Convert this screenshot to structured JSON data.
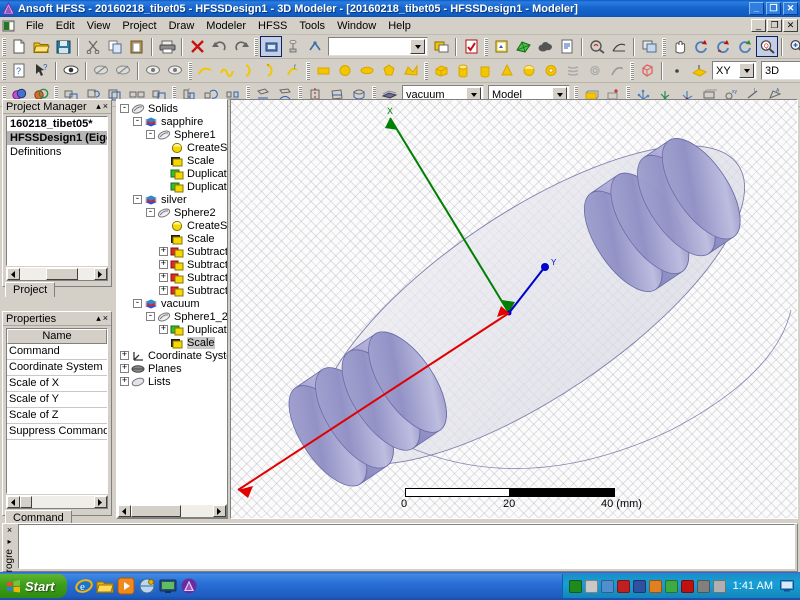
{
  "window": {
    "title": "Ansoft HFSS  - 20160218_tibet05 - HFSSDesign1 - 3D Modeler - [20160218_tibet05 - HFSSDesign1 - Modeler]",
    "app_icon": "ansoft-logo-icon",
    "buttons": {
      "minimize": "_",
      "restore": "❐",
      "close": "✕"
    },
    "mdi_buttons": {
      "minimize": "_",
      "restore": "❐",
      "close": "✕"
    }
  },
  "menubar": {
    "mdi_icon": "mdi-document-icon",
    "items": [
      "File",
      "Edit",
      "View",
      "Project",
      "Draw",
      "Modeler",
      "HFSS",
      "Tools",
      "Window",
      "Help"
    ]
  },
  "toolbars": {
    "row1": [
      {
        "type": "grip"
      },
      {
        "type": "button",
        "name": "new-file-button",
        "icon": "new-document-icon"
      },
      {
        "type": "button",
        "name": "open-file-button",
        "icon": "open-folder-icon"
      },
      {
        "type": "button",
        "name": "save-file-button",
        "icon": "floppy-save-icon"
      },
      {
        "type": "sep"
      },
      {
        "type": "button",
        "name": "cut-button",
        "icon": "scissors-icon"
      },
      {
        "type": "button",
        "name": "copy-button",
        "icon": "copy-icon"
      },
      {
        "type": "button",
        "name": "paste-button",
        "icon": "paste-icon"
      },
      {
        "type": "sep"
      },
      {
        "type": "button",
        "name": "print-button",
        "icon": "printer-icon"
      },
      {
        "type": "sep"
      },
      {
        "type": "button",
        "name": "delete-button",
        "icon": "red-x-icon"
      },
      {
        "type": "button",
        "name": "undo-button",
        "icon": "undo-arrow-icon"
      },
      {
        "type": "button",
        "name": "redo-button",
        "icon": "redo-arrow-icon"
      },
      {
        "type": "grip"
      },
      {
        "type": "button",
        "name": "select-object-button",
        "icon": "select-object-icon",
        "pressed": true
      },
      {
        "type": "button",
        "name": "select-face-button",
        "icon": "select-face-icon"
      },
      {
        "type": "button",
        "name": "select-edge-button",
        "icon": "select-edge-icon"
      },
      {
        "type": "combo",
        "name": "select-filter-combo",
        "value": ""
      },
      {
        "type": "button",
        "name": "select-multi-button",
        "icon": "multi-select-icon"
      },
      {
        "type": "sep"
      },
      {
        "type": "button",
        "name": "validate-button",
        "icon": "validation-check-icon"
      },
      {
        "type": "grip"
      },
      {
        "type": "button",
        "name": "analyze-all-button",
        "icon": "analyze-icon"
      },
      {
        "type": "button",
        "name": "mesh-button",
        "icon": "green-mesh-icon"
      },
      {
        "type": "button",
        "name": "cloud-button",
        "icon": "cloud-icon"
      },
      {
        "type": "button",
        "name": "report-button",
        "icon": "report-icon"
      },
      {
        "type": "sep"
      },
      {
        "type": "button",
        "name": "field-overlay-button",
        "icon": "field-overlay-icon"
      },
      {
        "type": "button",
        "name": "plot-curve-button",
        "icon": "plot-curve-icon"
      },
      {
        "type": "sep"
      },
      {
        "type": "button",
        "name": "duplicate-window-button",
        "icon": "window-copy-icon"
      },
      {
        "type": "grip"
      },
      {
        "type": "button",
        "name": "pan-button",
        "icon": "hand-pan-icon"
      },
      {
        "type": "button",
        "name": "rotate-button",
        "icon": "rotate-icon"
      },
      {
        "type": "button",
        "name": "dynamic-rotate-button",
        "icon": "rotate-dynamic-icon"
      },
      {
        "type": "button",
        "name": "spin-button",
        "icon": "spin-icon"
      },
      {
        "type": "button",
        "name": "zoom-button",
        "icon": "zoom-magnifier-icon",
        "pressed": true
      },
      {
        "type": "sep"
      },
      {
        "type": "button",
        "name": "zoom-in-button",
        "icon": "zoom-in-icon"
      },
      {
        "type": "button",
        "name": "zoom-out-button",
        "icon": "zoom-out-icon"
      },
      {
        "type": "sep"
      },
      {
        "type": "button",
        "name": "fit-all-button",
        "icon": "fit-all-icon"
      },
      {
        "type": "button",
        "name": "fit-selection-button",
        "icon": "fit-selection-icon"
      }
    ],
    "row2": [
      {
        "type": "grip"
      },
      {
        "type": "button",
        "name": "measure-button",
        "icon": "measure-help-icon"
      },
      {
        "type": "button",
        "name": "context-help-button",
        "icon": "arrow-help-icon"
      },
      {
        "type": "sep"
      },
      {
        "type": "button",
        "name": "view-all-button",
        "icon": "eye-view-icon"
      },
      {
        "type": "sep"
      },
      {
        "type": "button",
        "name": "hide-selection-button",
        "icon": "hide-object-icon"
      },
      {
        "type": "button",
        "name": "hide-unselected-button",
        "icon": "hide-unselected-icon"
      },
      {
        "type": "sep"
      },
      {
        "type": "button",
        "name": "show-selection-button",
        "icon": "show-object-icon"
      },
      {
        "type": "button",
        "name": "show-all-button",
        "icon": "show-all-icon"
      },
      {
        "type": "grip"
      },
      {
        "type": "button",
        "name": "draw-line-button",
        "icon": "draw-line-icon"
      },
      {
        "type": "button",
        "name": "draw-spline-button",
        "icon": "draw-spline-icon"
      },
      {
        "type": "button",
        "name": "draw-arc-center-button",
        "icon": "draw-arc-icon"
      },
      {
        "type": "button",
        "name": "draw-arc-3point-button",
        "icon": "draw-arc3-icon"
      },
      {
        "type": "button",
        "name": "draw-equation-button",
        "icon": "draw-equation-icon"
      },
      {
        "type": "grip"
      },
      {
        "type": "button",
        "name": "draw-rectangle-button",
        "icon": "rectangle-icon"
      },
      {
        "type": "button",
        "name": "draw-circle-button",
        "icon": "circle-icon"
      },
      {
        "type": "button",
        "name": "draw-ellipse-button",
        "icon": "ellipse-icon"
      },
      {
        "type": "button",
        "name": "draw-regular-polygon-button",
        "icon": "regular-polygon-icon"
      },
      {
        "type": "button",
        "name": "draw-polyline-button",
        "icon": "polyline-surface-icon"
      },
      {
        "type": "grip"
      },
      {
        "type": "button",
        "name": "draw-box-button",
        "icon": "box-icon"
      },
      {
        "type": "button",
        "name": "draw-cylinder-button",
        "icon": "cylinder-icon"
      },
      {
        "type": "button",
        "name": "draw-regular-polyhedron-button",
        "icon": "polyhedron-icon"
      },
      {
        "type": "button",
        "name": "draw-cone-button",
        "icon": "cone-icon"
      },
      {
        "type": "button",
        "name": "draw-sphere-button",
        "icon": "sphere-icon"
      },
      {
        "type": "button",
        "name": "draw-torus-button",
        "icon": "torus-icon"
      },
      {
        "type": "button",
        "name": "draw-helix-button",
        "icon": "helix-icon"
      },
      {
        "type": "button",
        "name": "draw-spiral-button",
        "icon": "spiral-icon"
      },
      {
        "type": "button",
        "name": "draw-bondwire-button",
        "icon": "bondwire-icon"
      },
      {
        "type": "grip"
      },
      {
        "type": "button",
        "name": "draw-user-defined-button",
        "icon": "user-defined-primitive-icon"
      },
      {
        "type": "sep"
      },
      {
        "type": "button",
        "name": "draw-point-button",
        "icon": "point-icon"
      },
      {
        "type": "button",
        "name": "draw-plane-button",
        "icon": "plane-icon"
      },
      {
        "type": "combo",
        "name": "grid-plane-combo",
        "value": "XY"
      },
      {
        "type": "combo",
        "name": "view-mode-combo",
        "value": "3D"
      }
    ],
    "row3": [
      {
        "type": "grip"
      },
      {
        "type": "button",
        "name": "boolean-unite-button",
        "icon": "unite-icon"
      },
      {
        "type": "button",
        "name": "boolean-subtract-button",
        "icon": "subtract-icon"
      },
      {
        "type": "grip"
      },
      {
        "type": "button",
        "name": "move-button",
        "icon": "move-icon"
      },
      {
        "type": "button",
        "name": "rotate-object-button",
        "icon": "rotate-object-icon"
      },
      {
        "type": "button",
        "name": "offset-button",
        "icon": "offset-icon"
      },
      {
        "type": "button",
        "name": "mirror-button",
        "icon": "mirror-pair-icon"
      },
      {
        "type": "button",
        "name": "scale-button",
        "icon": "scale-object-icon"
      },
      {
        "type": "grip"
      },
      {
        "type": "button",
        "name": "duplicate-mirror-button",
        "icon": "duplicate-mirror-icon"
      },
      {
        "type": "button",
        "name": "duplicate-around-axis-button",
        "icon": "duplicate-around-axis-icon"
      },
      {
        "type": "button",
        "name": "duplicate-along-line-button",
        "icon": "duplicate-along-line-icon"
      },
      {
        "type": "grip"
      },
      {
        "type": "button",
        "name": "sweep-around-axis-button",
        "icon": "sweep-axis-icon"
      },
      {
        "type": "button",
        "name": "sweep-along-path-button",
        "icon": "sweep-path-icon"
      },
      {
        "type": "grip"
      },
      {
        "type": "button",
        "name": "split-button",
        "icon": "split-icon"
      },
      {
        "type": "button",
        "name": "section-button",
        "icon": "section-icon"
      },
      {
        "type": "button",
        "name": "wrap-sheet-button",
        "icon": "wrap-sheet-icon"
      },
      {
        "type": "grip"
      },
      {
        "type": "button",
        "name": "thicken-sheet-button",
        "icon": "thicken-sheet-icon"
      },
      {
        "type": "combo",
        "name": "material-combo",
        "value": "vacuum"
      },
      {
        "type": "combo",
        "name": "solve-inside-combo",
        "value": "Model"
      },
      {
        "type": "grip"
      },
      {
        "type": "button",
        "name": "create-object-button",
        "icon": "create-object-icon"
      },
      {
        "type": "button",
        "name": "create-object-plus-button",
        "icon": "create-object-plus-icon"
      },
      {
        "type": "grip"
      },
      {
        "type": "button",
        "name": "coordinate-sys-face-button",
        "icon": "cs-face-icon"
      },
      {
        "type": "button",
        "name": "coordinate-sys-object-button",
        "icon": "cs-object-icon"
      },
      {
        "type": "button",
        "name": "coordinate-sys-global-button",
        "icon": "cs-global-icon"
      },
      {
        "type": "button",
        "name": "set-working-cs-button",
        "icon": "working-cs-icon"
      },
      {
        "type": "button",
        "name": "measure-position-button",
        "icon": "measure-position-icon"
      },
      {
        "type": "button",
        "name": "measure-length-button",
        "icon": "measure-length-icon"
      },
      {
        "type": "button",
        "name": "measure-area-button",
        "icon": "measure-area-icon"
      }
    ]
  },
  "project_manager": {
    "title": "Project Manager",
    "collapse_glyph": "▴",
    "close_glyph": "×",
    "items": [
      {
        "label": "160218_tibet05*",
        "bold": true,
        "selected": false
      },
      {
        "label": "HFSSDesign1 (Eige",
        "bold": true,
        "selected": true
      },
      {
        "label": "Definitions",
        "bold": false,
        "selected": false
      }
    ],
    "tab": "Project"
  },
  "properties": {
    "title": "Properties",
    "collapse_glyph": "▴",
    "close_glyph": "×",
    "column_header": "Name",
    "rows": [
      "Command",
      "Coordinate System",
      "Scale of X",
      "Scale of Y",
      "Scale of Z",
      "Suppress Command"
    ],
    "tab": "Command"
  },
  "model_tree": {
    "nodes": [
      {
        "depth": 0,
        "expander": "-",
        "icon": "solids-icon",
        "label": "Solids",
        "selected": false
      },
      {
        "depth": 1,
        "expander": "-",
        "icon": "material-icon",
        "label": "sapphire",
        "selected": false
      },
      {
        "depth": 2,
        "expander": "-",
        "icon": "object-icon",
        "label": "Sphere1",
        "selected": false
      },
      {
        "depth": 3,
        "expander": "",
        "icon": "create-sphere-icon",
        "label": "CreateS",
        "selected": false
      },
      {
        "depth": 3,
        "expander": "",
        "icon": "scale-cmd-icon",
        "label": "Scale",
        "selected": false
      },
      {
        "depth": 3,
        "expander": "",
        "icon": "duplicate-cmd-icon",
        "label": "Duplicat",
        "selected": false
      },
      {
        "depth": 3,
        "expander": "",
        "icon": "duplicate-cmd-icon",
        "label": "Duplicat",
        "selected": false
      },
      {
        "depth": 1,
        "expander": "-",
        "icon": "material-icon",
        "label": "silver",
        "selected": false
      },
      {
        "depth": 2,
        "expander": "-",
        "icon": "object-icon",
        "label": "Sphere2",
        "selected": false
      },
      {
        "depth": 3,
        "expander": "",
        "icon": "create-sphere-icon",
        "label": "CreateS",
        "selected": false
      },
      {
        "depth": 3,
        "expander": "",
        "icon": "scale-cmd-icon",
        "label": "Scale",
        "selected": false
      },
      {
        "depth": 3,
        "expander": "+",
        "icon": "subtract-cmd-icon",
        "label": "Subtract",
        "selected": false
      },
      {
        "depth": 3,
        "expander": "+",
        "icon": "subtract-cmd-icon",
        "label": "Subtract",
        "selected": false
      },
      {
        "depth": 3,
        "expander": "+",
        "icon": "subtract-cmd-icon",
        "label": "Subtract",
        "selected": false
      },
      {
        "depth": 3,
        "expander": "+",
        "icon": "subtract-cmd-icon",
        "label": "Subtract",
        "selected": false
      },
      {
        "depth": 1,
        "expander": "-",
        "icon": "material-icon",
        "label": "vacuum",
        "selected": false
      },
      {
        "depth": 2,
        "expander": "-",
        "icon": "object-icon",
        "label": "Sphere1_2",
        "selected": false
      },
      {
        "depth": 3,
        "expander": "+",
        "icon": "duplicate-cmd-icon",
        "label": "Duplicat",
        "selected": false
      },
      {
        "depth": 3,
        "expander": "",
        "icon": "scale-cmd-icon",
        "label": "Scale",
        "selected": true
      },
      {
        "depth": 0,
        "expander": "+",
        "icon": "coordinate-systems-icon",
        "label": "Coordinate Systems",
        "selected": false
      },
      {
        "depth": 0,
        "expander": "+",
        "icon": "planes-icon",
        "label": "Planes",
        "selected": false
      },
      {
        "depth": 0,
        "expander": "+",
        "icon": "lists-icon",
        "label": "Lists",
        "selected": false
      }
    ]
  },
  "viewport": {
    "axes": [
      {
        "name": "x-axis",
        "label": "X",
        "color": "#008000"
      },
      {
        "name": "y-axis",
        "label": "Y",
        "color": "#0000cc"
      },
      {
        "name": "z-axis",
        "label": "",
        "color": "#e00000"
      }
    ],
    "scale_bar": {
      "ticks": [
        "0",
        "20",
        "40 (mm)"
      ],
      "unit": "mm"
    },
    "colors": {
      "background": "#fbfbfc",
      "solid_fill": "#8c8cc0",
      "solid_highlight": "#b7b7dd",
      "shell_outline": "#5a5a96"
    }
  },
  "message_window": {
    "close_glyph": "×",
    "collapse_glyph": "▸",
    "side_label": "Progre",
    "content": ""
  },
  "taskbar": {
    "start_label": "Start",
    "quick_launch": [
      {
        "name": "internet-explorer-icon"
      },
      {
        "name": "file-explorer-icon"
      },
      {
        "name": "media-player-icon"
      },
      {
        "name": "network-globe-icon"
      },
      {
        "name": "desktop-icon"
      },
      {
        "name": "ansoft-app-icon"
      }
    ],
    "tray": [
      {
        "name": "green-square-icon",
        "color": "#1e8b1e"
      },
      {
        "name": "safety-remove-icon",
        "color": "#c8c8c8"
      },
      {
        "name": "blue-shield-icon",
        "color": "#4f8fd0"
      },
      {
        "name": "red-block-icon",
        "color": "#c02020"
      },
      {
        "name": "network-monitor-icon",
        "color": "#3050a0"
      },
      {
        "name": "volume-icon",
        "color": "#e08020"
      },
      {
        "name": "green-check-icon",
        "color": "#3faa3f"
      },
      {
        "name": "avira-icon",
        "color": "#c01010"
      },
      {
        "name": "network-disconnected-icon",
        "color": "#808080"
      },
      {
        "name": "speaker-icon",
        "color": "#b0b0b0"
      }
    ],
    "clock": "1:41 AM",
    "show-desktop": "show-desktop-icon"
  }
}
